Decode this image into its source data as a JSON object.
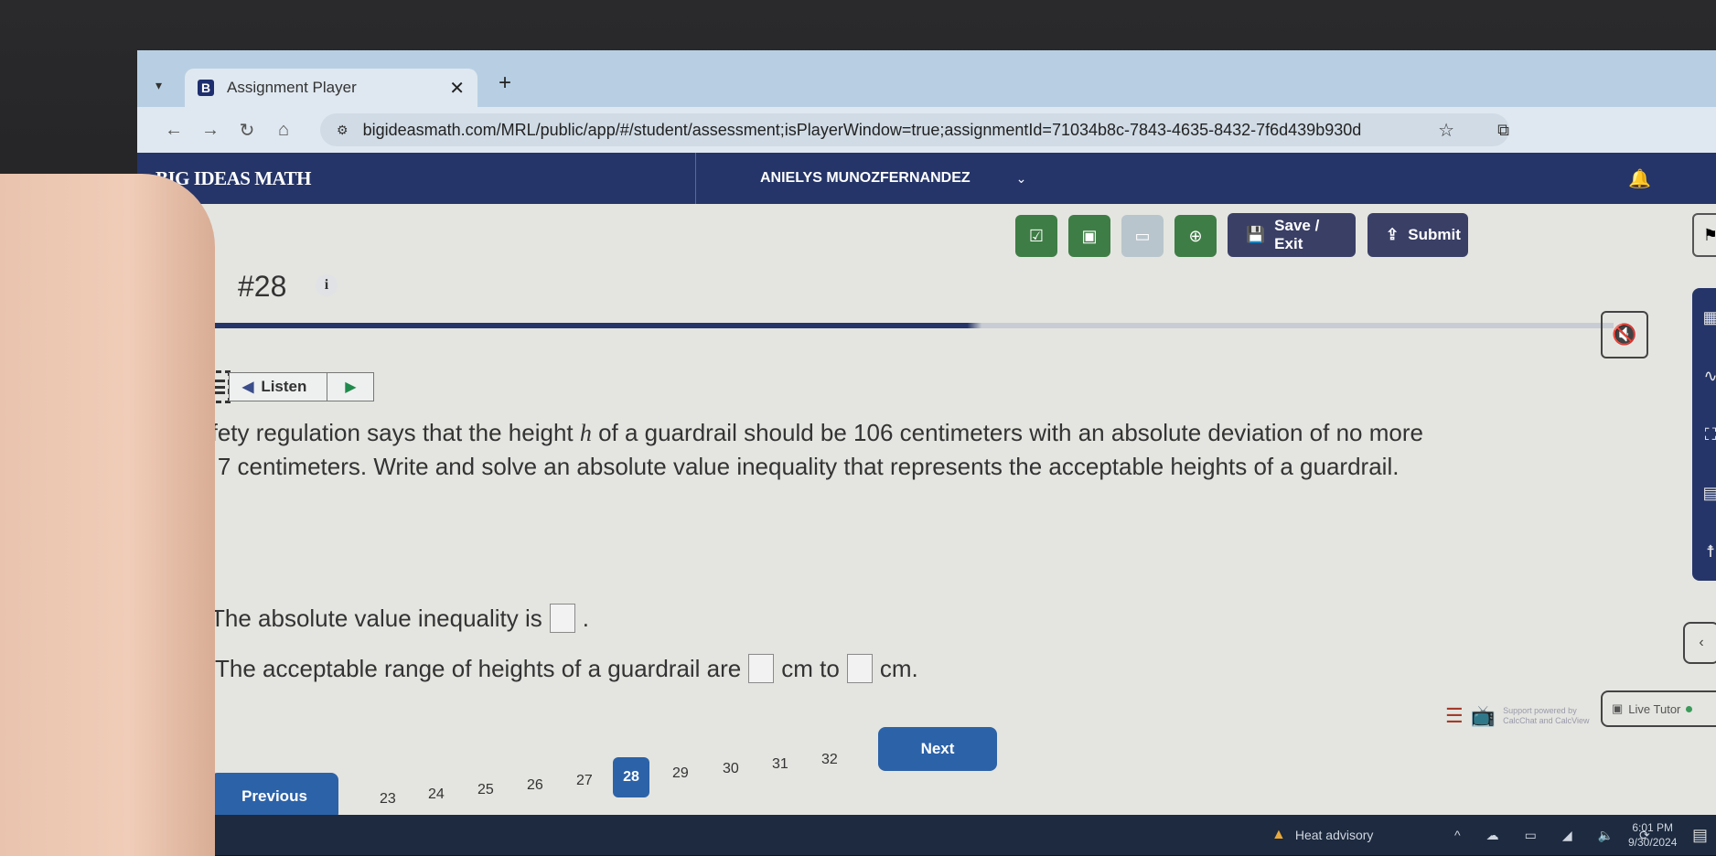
{
  "browser": {
    "tab_title": "Assignment Player",
    "tab_favicon": "B",
    "url": "bigideasmath.com/MRL/public/app/#/student/assessment;isPlayerWindow=true;assignmentId=71034b8c-7843-4635-8432-7f6d439b930d",
    "icons": {
      "tab_menu": "▾",
      "close": "✕",
      "new_tab": "+",
      "back": "←",
      "forward": "→",
      "reload": "↻",
      "home": "⌂",
      "site_info": "⚙",
      "bookmark": "☆",
      "extensions": "⧉"
    }
  },
  "header": {
    "brand": "BIG IDEAS MATH",
    "user_name": "ANIELYS MUNOZFERNANDEZ",
    "chevron": "⌄",
    "bell": "🔔"
  },
  "toolbar": {
    "tools": [
      {
        "name": "checklist",
        "glyph": "☑",
        "enabled": true
      },
      {
        "name": "whiteboard",
        "glyph": "▣",
        "enabled": true
      },
      {
        "name": "video",
        "glyph": "▭",
        "enabled": false
      },
      {
        "name": "help",
        "glyph": "⊕",
        "enabled": true
      }
    ],
    "save_exit": {
      "icon": "💾",
      "label": "Save / Exit"
    },
    "submit": {
      "icon": "⇪",
      "label": "Submit"
    },
    "flag": "⚑"
  },
  "question": {
    "number": "#28",
    "info": "i",
    "listen_label": "Listen",
    "speaker": "◀",
    "play": "▶",
    "mute": "🔇",
    "prompt_part1": "A safety regulation says that the height ",
    "variable": "h",
    "prompt_part2": " of a guardrail should be 106 centimeters with an absolute deviation of no more than 7 centimeters. Write and solve an absolute value inequality that represents the acceptable heights of a guardrail.",
    "line_a_text": "The absolute value inequality is",
    "line_a_end": ".",
    "line_a_value": "",
    "line_b_text": "The acceptable range of heights of a guardrail are",
    "line_b_mid": "cm to",
    "line_b_end": "cm.",
    "line_b_low": "",
    "line_b_high": ""
  },
  "side_tools": [
    "▦",
    "∿",
    "⛶",
    "▤",
    "☨"
  ],
  "collapse": "‹",
  "support": {
    "icon1": "☰",
    "icon2": "📺",
    "text": "Support powered by CalcChat and CalcView"
  },
  "live_tutor": {
    "icon": "▣",
    "label": "Live Tutor"
  },
  "pager": {
    "previous": "Previous",
    "next": "Next",
    "pages": [
      "23",
      "24",
      "25",
      "26",
      "27",
      "28",
      "29",
      "30",
      "31",
      "32"
    ],
    "current": "28"
  },
  "taskbar": {
    "weather": "Heat advisory",
    "warn_icon": "▲",
    "tray_icons": [
      "^",
      "☁",
      "▭",
      "◢",
      "🔈",
      "⟳"
    ],
    "time": "6:01 PM",
    "date": "9/30/2024",
    "notification": "▤"
  }
}
